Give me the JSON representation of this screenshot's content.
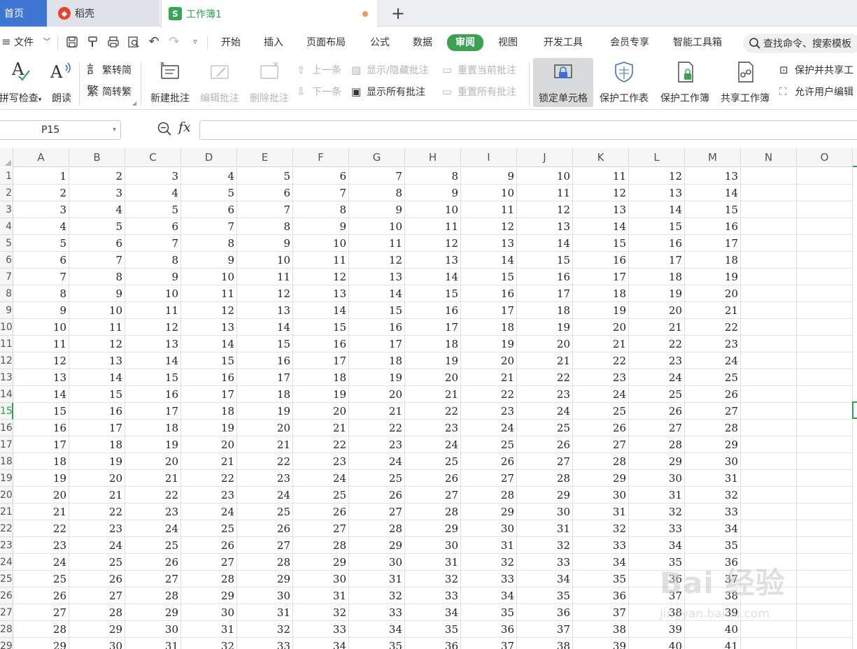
{
  "tabs": {
    "home": "首页",
    "shell": "稻壳",
    "workbook": "工作簿1",
    "new_tab": "+"
  },
  "menu": {
    "file": "文件",
    "items": [
      "开始",
      "插入",
      "页面布局",
      "公式",
      "数据",
      "审阅",
      "视图",
      "开发工具",
      "会员专享",
      "智能工具箱"
    ],
    "active": "审阅",
    "search_placeholder": "查找命令、搜索模板"
  },
  "ribbon": {
    "spellcheck": "拼写检查",
    "read_aloud": "朗读",
    "trad_to_simp": "繁转简",
    "simp_to_trad": "简转繁",
    "new_comment": "新建批注",
    "edit_comment": "编辑批注",
    "delete_comment": "删除批注",
    "prev": "上一条",
    "next": "下一条",
    "show_hide_comment": "显示/隐藏批注",
    "show_all_comments": "显示所有批注",
    "reset_current": "重置当前批注",
    "reset_all": "重置所有批注",
    "lock_cell": "锁定单元格",
    "protect_sheet": "保护工作表",
    "protect_book": "保护工作簿",
    "share_book": "共享工作簿",
    "protect_share": "保护并共享工",
    "allow_edit": "允许用户编辑"
  },
  "formula_bar": {
    "name_box": "P15",
    "fx": "fx",
    "formula": ""
  },
  "grid": {
    "columns": [
      "A",
      "B",
      "C",
      "D",
      "E",
      "F",
      "G",
      "H",
      "I",
      "J",
      "K",
      "L",
      "M",
      "N",
      "O"
    ],
    "row_labels": [
      "1",
      "2",
      "3",
      "4",
      "5",
      "6",
      "7",
      "8",
      "9",
      "10",
      "11",
      "12",
      "13",
      "14",
      "15",
      "16",
      "17",
      "18",
      "19",
      "20",
      "21",
      "22",
      "23",
      "24",
      "25",
      "26",
      "27",
      "28",
      "29"
    ],
    "active_row": "15",
    "rows": [
      [
        1,
        2,
        3,
        4,
        5,
        6,
        7,
        8,
        9,
        10,
        11,
        12,
        13
      ],
      [
        2,
        3,
        4,
        5,
        6,
        7,
        8,
        9,
        10,
        11,
        12,
        13,
        14
      ],
      [
        3,
        4,
        5,
        6,
        7,
        8,
        9,
        10,
        11,
        12,
        13,
        14,
        15
      ],
      [
        4,
        5,
        6,
        7,
        8,
        9,
        10,
        11,
        12,
        13,
        14,
        15,
        16
      ],
      [
        5,
        6,
        7,
        8,
        9,
        10,
        11,
        12,
        13,
        14,
        15,
        16,
        17
      ],
      [
        6,
        7,
        8,
        9,
        10,
        11,
        12,
        13,
        14,
        15,
        16,
        17,
        18
      ],
      [
        7,
        8,
        9,
        10,
        11,
        12,
        13,
        14,
        15,
        16,
        17,
        18,
        19
      ],
      [
        8,
        9,
        10,
        11,
        12,
        13,
        14,
        15,
        16,
        17,
        18,
        19,
        20
      ],
      [
        9,
        10,
        11,
        12,
        13,
        14,
        15,
        16,
        17,
        18,
        19,
        20,
        21
      ],
      [
        10,
        11,
        12,
        13,
        14,
        15,
        16,
        17,
        18,
        19,
        20,
        21,
        22
      ],
      [
        11,
        12,
        13,
        14,
        15,
        16,
        17,
        18,
        19,
        20,
        21,
        22,
        23
      ],
      [
        12,
        13,
        14,
        15,
        16,
        17,
        18,
        19,
        20,
        21,
        22,
        23,
        24
      ],
      [
        13,
        14,
        15,
        16,
        17,
        18,
        19,
        20,
        21,
        22,
        23,
        24,
        25
      ],
      [
        14,
        15,
        16,
        17,
        18,
        19,
        20,
        21,
        22,
        23,
        24,
        25,
        26
      ],
      [
        15,
        16,
        17,
        18,
        19,
        20,
        21,
        22,
        23,
        24,
        25,
        26,
        27
      ],
      [
        16,
        17,
        18,
        19,
        20,
        21,
        22,
        23,
        24,
        25,
        26,
        27,
        28
      ],
      [
        17,
        18,
        19,
        20,
        21,
        22,
        23,
        24,
        25,
        26,
        27,
        28,
        29
      ],
      [
        18,
        19,
        20,
        21,
        22,
        23,
        24,
        25,
        26,
        27,
        28,
        29,
        30
      ],
      [
        19,
        20,
        21,
        22,
        23,
        24,
        25,
        26,
        27,
        28,
        29,
        30,
        31
      ],
      [
        20,
        21,
        22,
        23,
        24,
        25,
        26,
        27,
        28,
        29,
        30,
        31,
        32
      ],
      [
        21,
        22,
        23,
        24,
        25,
        26,
        27,
        28,
        29,
        30,
        31,
        32,
        33
      ],
      [
        22,
        23,
        24,
        25,
        26,
        27,
        28,
        29,
        30,
        31,
        32,
        33,
        34
      ],
      [
        23,
        24,
        25,
        26,
        27,
        28,
        29,
        30,
        31,
        32,
        33,
        34,
        35
      ],
      [
        24,
        25,
        26,
        27,
        28,
        29,
        30,
        31,
        32,
        33,
        34,
        35,
        36
      ],
      [
        25,
        26,
        27,
        28,
        29,
        30,
        31,
        32,
        33,
        34,
        35,
        36,
        37
      ],
      [
        26,
        27,
        28,
        29,
        30,
        31,
        32,
        33,
        34,
        35,
        36,
        37,
        38
      ],
      [
        27,
        28,
        29,
        30,
        31,
        32,
        33,
        34,
        35,
        36,
        37,
        38,
        39
      ],
      [
        28,
        29,
        30,
        31,
        32,
        33,
        34,
        35,
        36,
        37,
        38,
        39,
        40
      ],
      [
        29,
        30,
        31,
        32,
        33,
        34,
        35,
        36,
        37,
        38,
        39,
        40,
        41
      ]
    ]
  },
  "watermark": {
    "text": "Bai 经验",
    "url": "jingyan.baidu.com"
  },
  "colors": {
    "accent_green": "#2e9e4f",
    "home_tab_blue": "#3f76d4",
    "active_menu_bg": "#3aa352"
  }
}
